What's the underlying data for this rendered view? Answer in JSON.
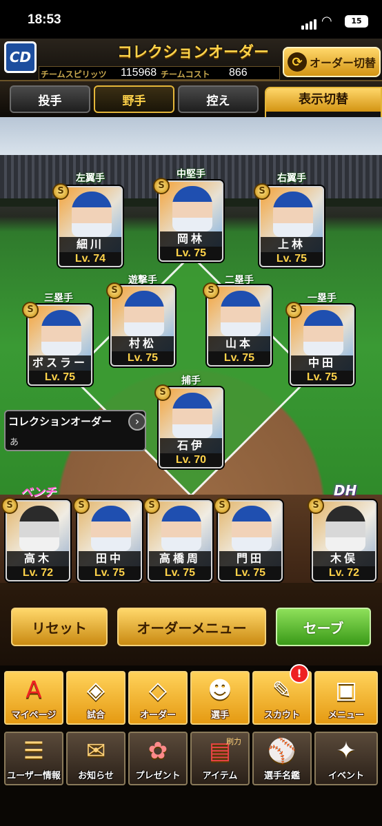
{
  "status": {
    "time": "18:53",
    "battery": "15"
  },
  "header": {
    "logo": "CD",
    "title": "コレクションオーダー",
    "spirit_label": "チームスピリッツ",
    "spirit_value": "115968",
    "cost_label": "チームコスト",
    "cost_value": "866",
    "order_switch_label": "オーダー切替"
  },
  "tabs": [
    "投手",
    "野手",
    "控え"
  ],
  "active_tab": "野手",
  "display_switch": {
    "label": "表示切替",
    "value": "ー"
  },
  "collection_order": {
    "title": "コレクションオーダー",
    "subtitle": "あ"
  },
  "positions": {
    "left": "左翼手",
    "center": "中堅手",
    "right": "右翼手",
    "third": "三塁手",
    "short": "遊撃手",
    "second": "二塁手",
    "first": "一塁手",
    "catcher": "捕手",
    "bench": "ベンチ",
    "dh": "DH"
  },
  "fielders": {
    "left": {
      "name": "細川",
      "level": "Lv. 74"
    },
    "center": {
      "name": "岡林",
      "level": "Lv. 75"
    },
    "right": {
      "name": "上林",
      "level": "Lv. 75"
    },
    "third": {
      "name": "ボスラー",
      "level": "Lv. 75"
    },
    "short": {
      "name": "村松",
      "level": "Lv. 75"
    },
    "second": {
      "name": "山本",
      "level": "Lv. 75"
    },
    "first": {
      "name": "中田",
      "level": "Lv. 75"
    },
    "catcher": {
      "name": "石伊",
      "level": "Lv. 70"
    }
  },
  "bench": [
    {
      "name": "高木",
      "level": "Lv. 72"
    },
    {
      "name": "田中",
      "level": "Lv. 75"
    },
    {
      "name": "高橋周",
      "level": "Lv. 75"
    },
    {
      "name": "門田",
      "level": "Lv. 75"
    }
  ],
  "dh": {
    "name": "木俣",
    "level": "Lv. 72"
  },
  "rank": "S",
  "actions": {
    "reset": "リセット",
    "order_menu": "オーダーメニュー",
    "save": "セーブ"
  },
  "menu_row1": [
    "マイページ",
    "試合",
    "オーダー",
    "選手",
    "スカウト",
    "メニュー"
  ],
  "menu_row2": [
    "ユーザー情報",
    "お知らせ",
    "プレゼント",
    "アイテム",
    "選手名鑑",
    "イベント"
  ],
  "scout_badge": "!",
  "item_tag": "刷力",
  "colors": {
    "gold": "#ffd34a",
    "save_green": "#58c22a",
    "bench_pink": "#ff5ad0"
  }
}
